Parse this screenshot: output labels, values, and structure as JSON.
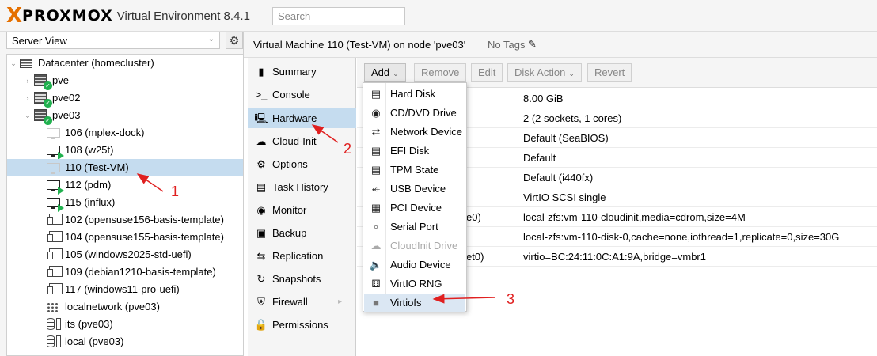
{
  "header": {
    "logo_x": "X",
    "logo_text": "PROXMOX",
    "product": "Virtual Environment 8.4.1",
    "search_placeholder": "Search"
  },
  "sidebar": {
    "view": "Server View",
    "tree": {
      "datacenter": "Datacenter (homecluster)",
      "nodes": [
        "pve",
        "pve02",
        "pve03"
      ],
      "guests": [
        {
          "label": "106 (mplex-dock)",
          "kind": "vm-stopped"
        },
        {
          "label": "108 (w25t)",
          "kind": "vm-running"
        },
        {
          "label": "110 (Test-VM)",
          "kind": "vm-stopped",
          "selected": true
        },
        {
          "label": "112 (pdm)",
          "kind": "vm-running"
        },
        {
          "label": "115 (influx)",
          "kind": "vm-running"
        },
        {
          "label": "102 (opensuse156-basis-template)",
          "kind": "template"
        },
        {
          "label": "104 (opensuse155-basis-template)",
          "kind": "template"
        },
        {
          "label": "105 (windows2025-std-uefi)",
          "kind": "template"
        },
        {
          "label": "109 (debian1210-basis-template)",
          "kind": "template"
        },
        {
          "label": "117 (windows11-pro-uefi)",
          "kind": "template"
        },
        {
          "label": "localnetwork (pve03)",
          "kind": "network"
        },
        {
          "label": "its (pve03)",
          "kind": "storage"
        },
        {
          "label": "local (pve03)",
          "kind": "storage"
        }
      ]
    }
  },
  "vm_header": {
    "title": "Virtual Machine 110 (Test-VM) on node 'pve03'",
    "tags": "No Tags"
  },
  "nav": {
    "items": [
      "Summary",
      "Console",
      "Hardware",
      "Cloud-Init",
      "Options",
      "Task History",
      "Monitor",
      "Backup",
      "Replication",
      "Snapshots",
      "Firewall",
      "Permissions"
    ],
    "selected": "Hardware"
  },
  "toolbar": {
    "add": "Add",
    "remove": "Remove",
    "edit": "Edit",
    "disk_action": "Disk Action",
    "revert": "Revert"
  },
  "hardware_rows": [
    {
      "key": "",
      "value": "8.00 GiB"
    },
    {
      "key": "",
      "value": "2 (2 sockets, 1 cores)"
    },
    {
      "key": "",
      "value": "Default (SeaBIOS)"
    },
    {
      "key": "",
      "value": "Default"
    },
    {
      "key": "",
      "value": "Default (i440fx)"
    },
    {
      "key": "",
      "value": "VirtIO SCSI single"
    },
    {
      "key": "e0)",
      "value": "local-zfs:vm-110-cloudinit,media=cdrom,size=4M"
    },
    {
      "key": "",
      "value": "local-zfs:vm-110-disk-0,cache=none,iothread=1,replicate=0,size=30G"
    },
    {
      "key": "et0)",
      "value": "virtio=BC:24:11:0C:A1:9A,bridge=vmbr1"
    }
  ],
  "add_menu": {
    "items": [
      {
        "label": "Hard Disk",
        "icon": "hdd-icon"
      },
      {
        "label": "CD/DVD Drive",
        "icon": "disc-icon"
      },
      {
        "label": "Network Device",
        "icon": "exchange-icon"
      },
      {
        "label": "EFI Disk",
        "icon": "hdd-icon"
      },
      {
        "label": "TPM State",
        "icon": "hdd-icon"
      },
      {
        "label": "USB Device",
        "icon": "usb-icon"
      },
      {
        "label": "PCI Device",
        "icon": "pci-card-icon"
      },
      {
        "label": "Serial Port",
        "icon": "serial-port-icon"
      },
      {
        "label": "CloudInit Drive",
        "icon": "cloud-icon",
        "disabled": true
      },
      {
        "label": "Audio Device",
        "icon": "speaker-icon"
      },
      {
        "label": "VirtIO RNG",
        "icon": "dice-icon"
      },
      {
        "label": "Virtiofs",
        "icon": "folder-icon",
        "highlighted": true
      }
    ]
  },
  "annotations": [
    "1",
    "2",
    "3"
  ],
  "colors": {
    "accent_orange": "#e57000",
    "selection": "#c5dcef",
    "running_green": "#21b14f",
    "annotation_red": "#e02020"
  }
}
